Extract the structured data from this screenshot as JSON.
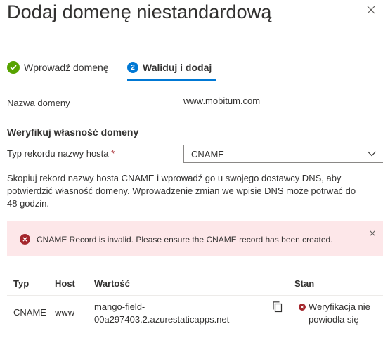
{
  "panel": {
    "title": "Dodaj domenę niestandardową"
  },
  "steps": [
    {
      "label": "Wprowadź domenę",
      "state": "complete"
    },
    {
      "number": "2",
      "label": "Waliduj i dodaj",
      "state": "active"
    }
  ],
  "domain": {
    "label": "Nazwa domeny",
    "value": "www.mobitum.com"
  },
  "verify": {
    "title": "Weryfikuj własność domeny",
    "record_type_label": "Typ rekordu nazwy hosta",
    "required_marker": "*",
    "record_type_value": "CNAME",
    "description": "Skopiuj rekord nazwy hosta CNAME i wprowadź go u swojego dostawcy DNS, aby potwierdzić własność domeny. Wprowadzenie zmian we wpisie DNS może potrwać do 48 godzin."
  },
  "error": {
    "message": "CNAME Record is invalid.  Please ensure the CNAME record has been created."
  },
  "table": {
    "headers": {
      "type": "Typ",
      "host": "Host",
      "value": "Wartość",
      "status": "Stan"
    },
    "rows": [
      {
        "type": "CNAME",
        "host": "www",
        "value": "mango-field-00a297403.2.azurestaticapps.net",
        "status": "Weryfikacja nie powiodła się"
      }
    ]
  },
  "colors": {
    "accent": "#0078d4",
    "success": "#57a300",
    "error": "#a4262c",
    "error_bg": "#fde7e9"
  },
  "icons": {
    "close": "close-icon",
    "step_done": "checkmark-circle-icon",
    "select": "chevron-down-icon",
    "error": "error-circle-icon",
    "copy": "copy-icon",
    "status": "error-circle-icon"
  }
}
